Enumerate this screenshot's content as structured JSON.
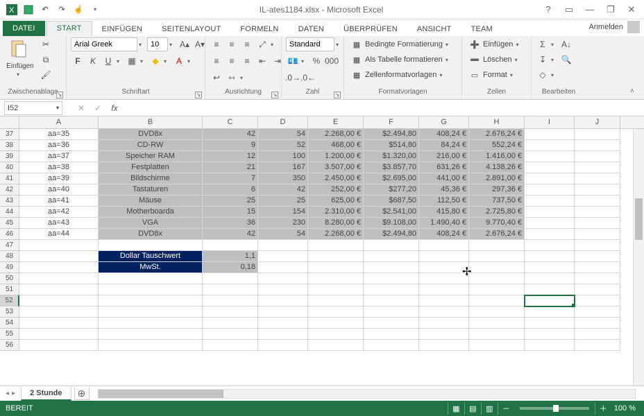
{
  "title": "IL-ates1184.xlsx - Microsoft Excel",
  "signin": "Anmelden",
  "tabs": {
    "file": "DATEI",
    "list": [
      "START",
      "EINFÜGEN",
      "SEITENLAYOUT",
      "FORMELN",
      "DATEN",
      "ÜBERPRÜFEN",
      "ANSICHT",
      "Team"
    ],
    "active": 0
  },
  "ribbon": {
    "clipboard": {
      "label": "Zwischenablage",
      "paste": "Einfügen"
    },
    "font": {
      "label": "Schriftart",
      "name": "Arial Greek",
      "size": "10",
      "bold": "F",
      "italic": "K",
      "underline": "U"
    },
    "align": {
      "label": "Ausrichtung"
    },
    "number": {
      "label": "Zahl",
      "format": "Standard"
    },
    "styles": {
      "label": "Formatvorlagen",
      "cond": "Bedingte Formatierung",
      "table": "Als Tabelle formatieren",
      "cell": "Zellenformatvorlagen"
    },
    "cells": {
      "label": "Zellen",
      "insert": "Einfügen",
      "delete": "Löschen",
      "format": "Format"
    },
    "editing": {
      "label": "Bearbeiten"
    }
  },
  "namebox": "I52",
  "formula": "",
  "columns": [
    "A",
    "B",
    "C",
    "D",
    "E",
    "F",
    "G",
    "H",
    "I",
    "J"
  ],
  "rowStart": 37,
  "data": [
    {
      "r": 37,
      "a": "aa=35",
      "b": "DVD8x",
      "c": "42",
      "d": "54",
      "e": "2.268,00 €",
      "f": "$2.494,80",
      "g": "408,24 €",
      "h": "2.676,24 €"
    },
    {
      "r": 38,
      "a": "aa=36",
      "b": "CD-RW",
      "c": "9",
      "d": "52",
      "e": "468,00 €",
      "f": "$514,80",
      "g": "84,24 €",
      "h": "552,24 €"
    },
    {
      "r": 39,
      "a": "aa=37",
      "b": "Speicher RAM",
      "c": "12",
      "d": "100",
      "e": "1.200,00 €",
      "f": "$1.320,00",
      "g": "216,00 €",
      "h": "1.416,00 €"
    },
    {
      "r": 40,
      "a": "aa=38",
      "b": "Festplatten",
      "c": "21",
      "d": "167",
      "e": "3.507,00 €",
      "f": "$3.857,70",
      "g": "631,26 €",
      "h": "4.138,26 €"
    },
    {
      "r": 41,
      "a": "aa=39",
      "b": "Bildschirme",
      "c": "7",
      "d": "350",
      "e": "2.450,00 €",
      "f": "$2.695,00",
      "g": "441,00 €",
      "h": "2.891,00 €"
    },
    {
      "r": 42,
      "a": "aa=40",
      "b": "Tastaturen",
      "c": "6",
      "d": "42",
      "e": "252,00 €",
      "f": "$277,20",
      "g": "45,36 €",
      "h": "297,36 €"
    },
    {
      "r": 43,
      "a": "aa=41",
      "b": "Mäuse",
      "c": "25",
      "d": "25",
      "e": "625,00 €",
      "f": "$687,50",
      "g": "112,50 €",
      "h": "737,50 €"
    },
    {
      "r": 44,
      "a": "aa=42",
      "b": "Motherboarda",
      "c": "15",
      "d": "154",
      "e": "2.310,00 €",
      "f": "$2.541,00",
      "g": "415,80 €",
      "h": "2.725,80 €"
    },
    {
      "r": 45,
      "a": "aa=43",
      "b": "VGA",
      "c": "36",
      "d": "230",
      "e": "8.280,00 €",
      "f": "$9.108,00",
      "g": "1.490,40 €",
      "h": "9.770,40 €"
    },
    {
      "r": 46,
      "a": "aa=44",
      "b": "DVD8x",
      "c": "42",
      "d": "54",
      "e": "2.268,00 €",
      "f": "$2.494,80",
      "g": "408,24 €",
      "h": "2.676,24 €"
    }
  ],
  "extra": {
    "r48b": "Dollar Tauschwert",
    "r48c": "1,1",
    "r49b": "MwSt.",
    "r49c": "0,18"
  },
  "sheet": {
    "active": "2 Stunde"
  },
  "status": {
    "ready": "BEREIT",
    "zoom": "100 %"
  }
}
